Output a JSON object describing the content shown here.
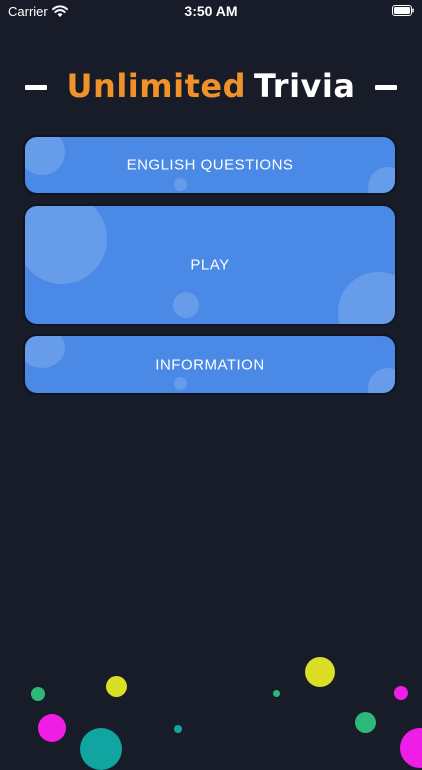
{
  "status_bar": {
    "carrier": "Carrier",
    "time": "3:50 AM"
  },
  "header": {
    "title_part1": "Unlimited",
    "title_part2": "Trivia"
  },
  "menu": {
    "english_label": "ENGLISH QUESTIONS",
    "play_label": "PLAY",
    "info_label": "INFORMATION"
  },
  "colors": {
    "background": "#181c28",
    "button": "#4b89e6",
    "title_accent": "#f0922a",
    "dot_yellow": "#d8df25",
    "dot_green": "#2db87a",
    "dot_magenta": "#ef1ee6",
    "dot_teal": "#10a5a0"
  }
}
